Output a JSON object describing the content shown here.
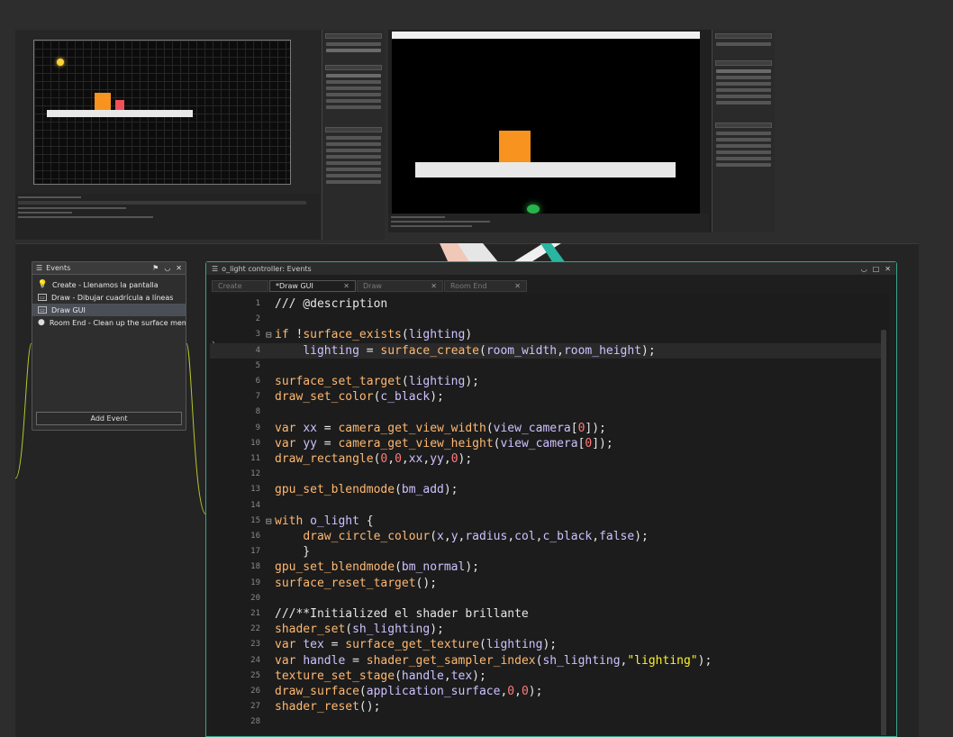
{
  "colors": {
    "accent": "#3aa38a",
    "keyword": "#ffb871",
    "builtin": "#cfc1ff",
    "number": "#ff7a7a",
    "string": "#fcf320",
    "selection_row": "#4a4f57"
  },
  "events_panel": {
    "title": "Events",
    "items": [
      {
        "label": "Create - Llenamos la pantalla",
        "icon": "lightbulb-icon"
      },
      {
        "label": "Draw - Dibujar cuadrícula a líneas",
        "icon": "draw-event-icon"
      },
      {
        "label": "Draw GUI",
        "icon": "draw-event-icon",
        "selected": true
      },
      {
        "label": "Room End - Clean up the surface memo",
        "icon": "room-end-icon"
      }
    ],
    "add_button": "Add Event"
  },
  "code_window": {
    "title": "o_light controller: Events",
    "tabs": [
      {
        "label": "Create"
      },
      {
        "label": "*Draw GUI",
        "active": true
      },
      {
        "label": "Draw"
      },
      {
        "label": "Room End"
      }
    ],
    "lines": [
      {
        "n": "1",
        "text": "/// @description"
      },
      {
        "n": "2",
        "text": ""
      },
      {
        "n": "3",
        "text": "if !surface_exists(lighting)"
      },
      {
        "n": "4",
        "text": "    lighting = surface_create(room_width,room_height);"
      },
      {
        "n": "5",
        "text": ""
      },
      {
        "n": "6",
        "text": "surface_set_target(lighting);"
      },
      {
        "n": "7",
        "text": "draw_set_color(c_black);"
      },
      {
        "n": "8",
        "text": ""
      },
      {
        "n": "9",
        "text": "var xx = camera_get_view_width(view_camera[0]);"
      },
      {
        "n": "10",
        "text": "var yy = camera_get_view_height(view_camera[0]);"
      },
      {
        "n": "11",
        "text": "draw_rectangle(0,0,xx,yy,0);"
      },
      {
        "n": "12",
        "text": ""
      },
      {
        "n": "13",
        "text": "gpu_set_blendmode(bm_add);"
      },
      {
        "n": "14",
        "text": ""
      },
      {
        "n": "15",
        "text": "with o_light {"
      },
      {
        "n": "16",
        "text": "    draw_circle_colour(x,y,radius,col,c_black,false);"
      },
      {
        "n": "17",
        "text": "    }"
      },
      {
        "n": "18",
        "text": "gpu_set_blendmode(bm_normal);"
      },
      {
        "n": "19",
        "text": "surface_reset_target();"
      },
      {
        "n": "20",
        "text": ""
      },
      {
        "n": "21",
        "text": "///**Initialized el shader brillante"
      },
      {
        "n": "22",
        "text": "shader_set(sh_lighting);"
      },
      {
        "n": "23",
        "text": "var tex = surface_get_texture(lighting);"
      },
      {
        "n": "24",
        "text": "var handle = shader_get_sampler_index(sh_lighting,\"lighting\");"
      },
      {
        "n": "25",
        "text": "texture_set_stage(handle,tex);"
      },
      {
        "n": "26",
        "text": "draw_surface(application_surface,0,0);"
      },
      {
        "n": "27",
        "text": "shader_reset();"
      },
      {
        "n": "28",
        "text": ""
      }
    ]
  }
}
